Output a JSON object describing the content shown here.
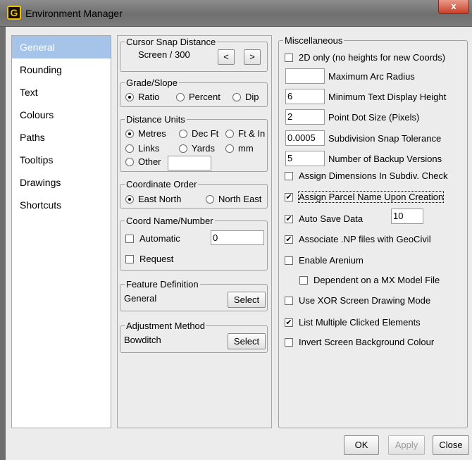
{
  "window": {
    "title": "Environment Manager",
    "close": "x"
  },
  "nav": [
    "General",
    "Rounding",
    "Text",
    "Colours",
    "Paths",
    "Tooltips",
    "Drawings",
    "Shortcuts"
  ],
  "cursor_snap": {
    "legend": "Cursor Snap Distance",
    "value": "Screen / 300",
    "dec": "<",
    "inc": ">"
  },
  "grade_slope": {
    "legend": "Grade/Slope",
    "options": [
      "Ratio",
      "Percent",
      "Dip"
    ],
    "selected": "Ratio"
  },
  "distance_units": {
    "legend": "Distance Units",
    "options": [
      "Metres",
      "Dec Ft",
      "Ft & In",
      "Links",
      "Yards",
      "mm",
      "Other"
    ],
    "selected": "Metres",
    "other_value": ""
  },
  "coordinate_order": {
    "legend": "Coordinate Order",
    "options": [
      "East North",
      "North East"
    ],
    "selected": "East North"
  },
  "coord_name": {
    "legend": "Coord Name/Number",
    "automatic": {
      "label": "Automatic",
      "checked": false,
      "value": "0"
    },
    "request": {
      "label": "Request",
      "checked": false
    }
  },
  "feature_definition": {
    "legend": "Feature Definition",
    "value": "General",
    "button": "Select"
  },
  "adjustment_method": {
    "legend": "Adjustment Method",
    "value": "Bowditch",
    "button": "Select"
  },
  "misc": {
    "legend": "Miscellaneous",
    "two_d_only": {
      "label": "2D only (no heights for new Coords)",
      "checked": false
    },
    "max_arc_radius": {
      "label": "Maximum Arc Radius",
      "value": ""
    },
    "min_text_height": {
      "label": "Minimum Text Display Height",
      "value": "6"
    },
    "point_dot_size": {
      "label": "Point Dot Size (Pixels)",
      "value": "2"
    },
    "subdiv_snap": {
      "label": "Subdivision Snap Tolerance",
      "value": "0.0005"
    },
    "backup_versions": {
      "label": "Number of Backup Versions",
      "value": "5"
    },
    "assign_dimensions": {
      "label": "Assign Dimensions In Subdiv. Check",
      "checked": false
    },
    "assign_parcel_name": {
      "label": "Assign Parcel Name Upon Creation",
      "checked": true
    },
    "auto_save": {
      "label": "Auto Save Data",
      "checked": true,
      "value": "10"
    },
    "associate_np": {
      "label": "Associate .NP files with GeoCivil",
      "checked": true
    },
    "enable_arenium": {
      "label": "Enable Arenium",
      "checked": false
    },
    "dependent_mx": {
      "label": "Dependent on a MX Model File",
      "checked": false
    },
    "xor_mode": {
      "label": "Use XOR Screen Drawing Mode",
      "checked": false
    },
    "list_multiple": {
      "label": "List Multiple Clicked  Elements",
      "checked": true
    },
    "invert_bg": {
      "label": "Invert Screen Background Colour",
      "checked": false
    }
  },
  "footer": {
    "ok": "OK",
    "apply": "Apply",
    "close": "Close"
  },
  "check_mark": "✔"
}
